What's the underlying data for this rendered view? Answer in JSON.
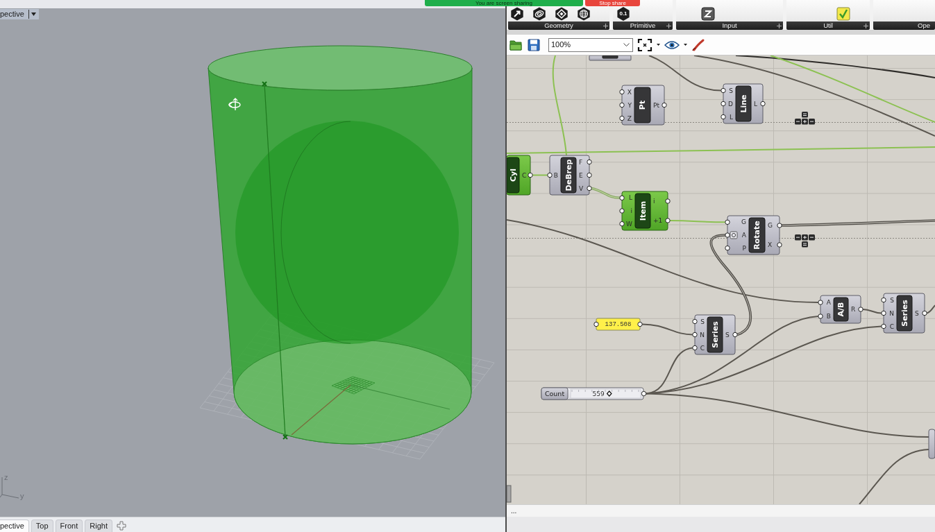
{
  "screen_share": {
    "message": "You are screen sharing",
    "stop_button": "Stop share"
  },
  "rhino": {
    "viewport_label": "pective",
    "axis_labels": [
      "z",
      "y"
    ],
    "viewport_tabs": [
      {
        "label": "pective",
        "selected": true
      },
      {
        "label": "Top",
        "selected": false
      },
      {
        "label": "Front",
        "selected": false
      },
      {
        "label": "Right",
        "selected": false
      }
    ]
  },
  "grasshopper": {
    "ribbon": [
      {
        "label": "Geometry"
      },
      {
        "label": "Primitive",
        "icon_labels": [
          "0.1"
        ]
      },
      {
        "label": "Input"
      },
      {
        "label": "Util"
      },
      {
        "label": "Ope"
      }
    ],
    "toolbar": {
      "zoom": "100%"
    },
    "canvas": {
      "components": [
        {
          "selected": false
        },
        {
          "name": "Pt",
          "inputs": [
            {
              "label": "X",
              "flag": false
            },
            {
              "label": "Y",
              "flag": false
            },
            {
              "label": "Z",
              "flag": false
            }
          ],
          "outputs": [
            "Pt"
          ],
          "selected": false
        },
        {
          "name": "Line",
          "inputs": [
            {
              "label": "S",
              "flag": false
            },
            {
              "label": "D",
              "flag": false
            },
            {
              "label": "L",
              "flag": false
            }
          ],
          "outputs": [
            "L"
          ],
          "selected": false
        },
        {
          "name": "Cyl",
          "outputs": [
            "C"
          ],
          "selected": true
        },
        {
          "name": "DeBrep",
          "inputs": [
            {
              "label": "B",
              "flag": false
            }
          ],
          "outputs": [
            "F",
            "E",
            "V"
          ],
          "selected": false
        },
        {
          "name": "Item",
          "inputs": [
            {
              "label": "L",
              "flag": false
            },
            {
              "label": "i",
              "flag": false
            },
            {
              "label": "W",
              "flag": false
            }
          ],
          "outputs": [
            "i",
            "+1"
          ],
          "selected": true
        },
        {
          "name": "Rotate",
          "inputs": [
            {
              "label": "G",
              "flag": false
            },
            {
              "label": "A",
              "flag": true
            },
            {
              "label": "P",
              "flag": false
            }
          ],
          "outputs": [
            "G",
            "X"
          ],
          "selected": false
        },
        {
          "name": "Series",
          "inputs": [
            {
              "label": "S",
              "flag": false
            },
            {
              "label": "N",
              "flag": false
            },
            {
              "label": "C",
              "flag": false
            }
          ],
          "outputs": [
            "S"
          ],
          "selected": false
        },
        {
          "name": "A/B",
          "inputs": [
            {
              "label": "A",
              "flag": false
            },
            {
              "label": "B",
              "flag": false
            }
          ],
          "outputs": [
            "R"
          ],
          "selected": false
        },
        {
          "name": "Series",
          "inputs": [
            {
              "label": "S",
              "flag": false
            },
            {
              "label": "N",
              "flag": false
            },
            {
              "label": "C",
              "flag": false
            }
          ],
          "outputs": [
            "S"
          ],
          "selected": false
        },
        {
          "selected": false
        }
      ],
      "panel": {
        "value": "137.508"
      },
      "slider": {
        "label": "Count",
        "value": "559",
        "level": 0.56
      }
    },
    "status_bar": {
      "text": "..."
    }
  }
}
